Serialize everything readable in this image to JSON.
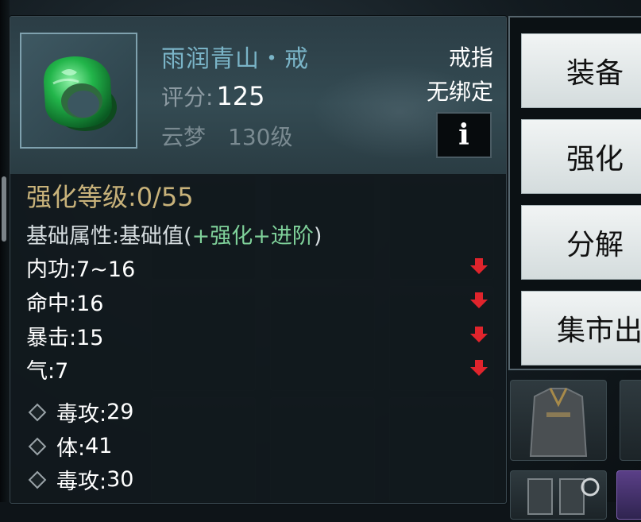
{
  "item": {
    "name": "雨润青山・戒",
    "score_label": "评分:",
    "score_value": "125",
    "sect": "云梦",
    "level": "130级",
    "type": "戒指",
    "bind": "无绑定",
    "info_button": "i",
    "icon": "jade-ring-icon"
  },
  "enhance": {
    "label": "强化等级:",
    "value": "0/55"
  },
  "base_attr": {
    "prefix": "基础属性:基础值(",
    "plus1": "+强化",
    "plus2": "+进阶",
    "suffix": ")"
  },
  "stats": [
    {
      "label": "内功:",
      "value": "7~16",
      "trend": "down"
    },
    {
      "label": "命中:",
      "value": "16",
      "trend": "down"
    },
    {
      "label": "暴击:",
      "value": "15",
      "trend": "down"
    },
    {
      "label": "气:",
      "value": "7",
      "trend": "down"
    }
  ],
  "sub_stats": [
    {
      "label": "毒攻:",
      "value": "29"
    },
    {
      "label": "体:",
      "value": "41"
    },
    {
      "label": "毒攻:",
      "value": "30"
    }
  ],
  "actions": [
    {
      "label": "装备"
    },
    {
      "label": "强化"
    },
    {
      "label": "分解"
    },
    {
      "label": "集市出"
    }
  ],
  "colors": {
    "title": "#7ab4c7",
    "enhance": "#c8b27a",
    "highlight_green": "#7fd19a",
    "down_arrow": "#e0242c"
  }
}
